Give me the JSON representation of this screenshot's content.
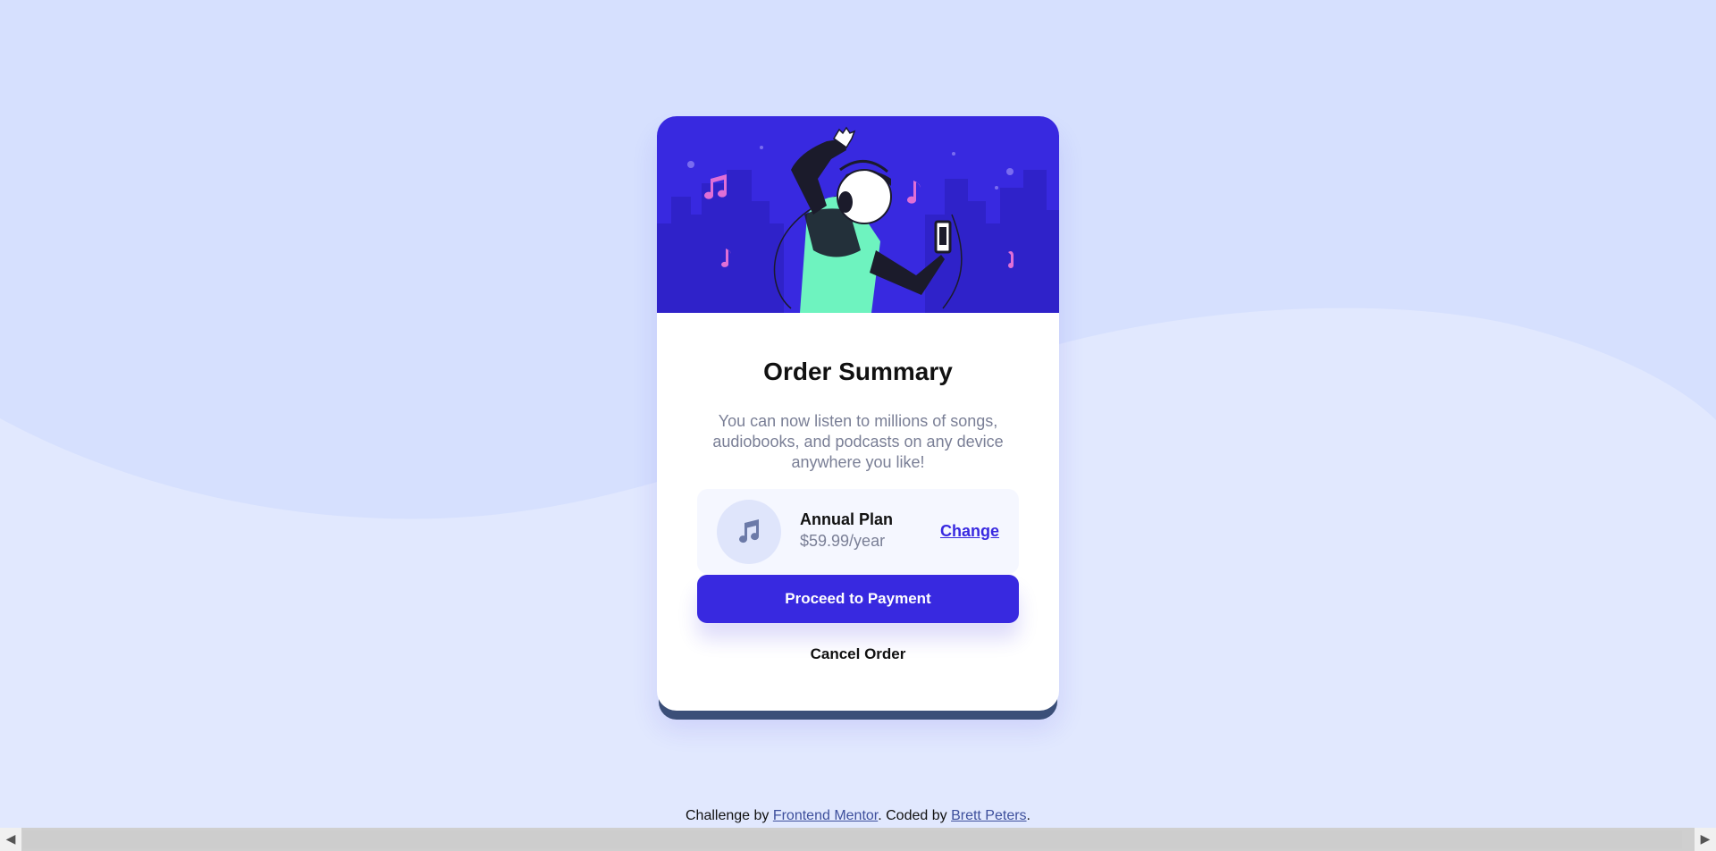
{
  "card": {
    "title": "Order Summary",
    "description": "You can now listen to millions of songs, audiobooks, and podcasts on any device anywhere you like!",
    "plan": {
      "name": "Annual Plan",
      "price": "$59.99/year",
      "change_label": "Change",
      "icon": "music-note-icon"
    },
    "pay_label": "Proceed to Payment",
    "cancel_label": "Cancel Order"
  },
  "footer": {
    "prefix": "Challenge by ",
    "link1": "Frontend Mentor",
    "middle": ". Coded by ",
    "link2": "Brett Peters",
    "suffix": "."
  },
  "colors": {
    "background": "#d6e0fe",
    "wave": "#e1e8fe",
    "accent": "#3829e0",
    "muted_text": "#7a7f96",
    "plan_bg": "#f5f7ff"
  }
}
